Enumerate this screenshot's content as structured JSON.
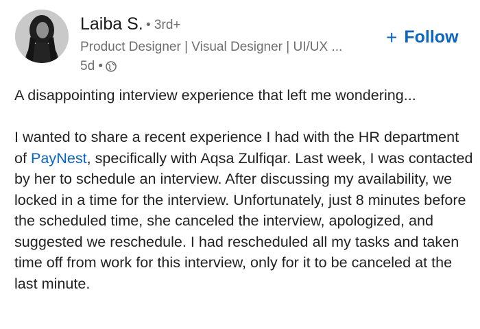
{
  "author": {
    "name": "Laiba S.",
    "degree": "• 3rd+",
    "headline": "Product Designer | Visual Designer | UI/UX ...",
    "time": "5d •",
    "visibility_icon": "globe-icon"
  },
  "actions": {
    "follow_label": "Follow",
    "follow_icon": "plus-icon"
  },
  "post": {
    "intro": "A disappointing interview experience that left me wondering...",
    "body_before_mention": "I wanted to share a recent experience I had with the HR department of",
    "mention": "PayNest",
    "body_after_mention": ", specifically with Aqsa Zulfiqar. Last week, I was contacted by her to schedule an interview. After discussing my availability, we locked in a time for the interview. Unfortunately, just 8 minutes before the scheduled time, she canceled the interview, apologized, and suggested we reschedule. I had rescheduled all my tasks and taken time off from work for this interview, only for it to be canceled at the last minute."
  },
  "colors": {
    "link": "#0a66c2",
    "secondary_text": "#6e6e6e",
    "primary_text": "#222222"
  }
}
